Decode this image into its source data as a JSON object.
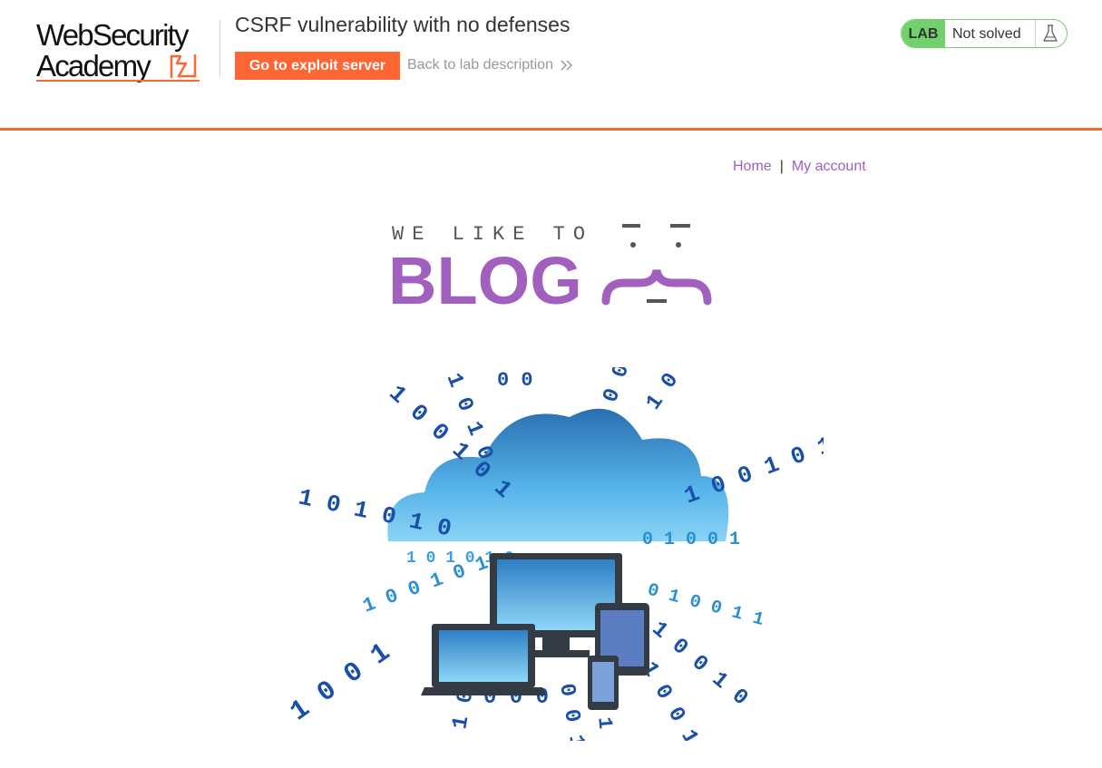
{
  "academy": {
    "logo_line1": "WebSecurity",
    "logo_line2": "Academy",
    "lab_title": "CSRF vulnerability with no defenses",
    "exploit_button": "Go to exploit server",
    "back_link": "Back to lab description",
    "lab_badge": "LAB",
    "lab_status": "Not solved",
    "accent_color": "#ff6633",
    "status_color": "#70d16d"
  },
  "blog": {
    "nav": {
      "home": "Home",
      "separator": "|",
      "my_account": "My account"
    },
    "banner": {
      "tagline": "WE LIKE TO",
      "word": "BLOG",
      "brace": "{"
    },
    "link_color": "#a15fbe"
  }
}
